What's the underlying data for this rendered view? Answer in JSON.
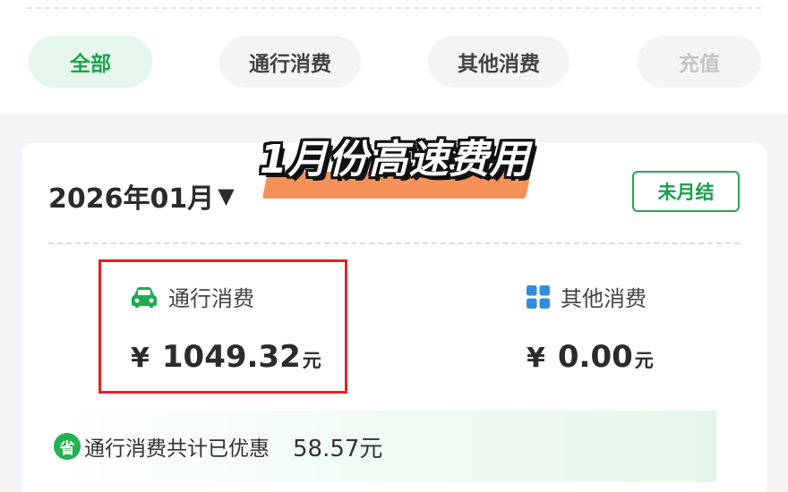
{
  "tabs": [
    {
      "label": "全部"
    },
    {
      "label": "通行消费"
    },
    {
      "label": "其他消费"
    },
    {
      "label": "充值"
    }
  ],
  "overlay": {
    "title": "1月份高速费用"
  },
  "summary": {
    "month": "2026年01月",
    "caret": "▼",
    "status_label": "未月结"
  },
  "toll": {
    "icon": "car-icon",
    "label": "通行消费",
    "currency": "¥",
    "amount": "1049.32",
    "unit": "元"
  },
  "other": {
    "icon": "grid-icon",
    "label": "其他消费",
    "currency": "¥",
    "amount": "0.00",
    "unit": "元"
  },
  "discount": {
    "badge": "省",
    "label": "通行消费共计已优惠",
    "value": "58.57元"
  },
  "colors": {
    "accent": "#17a74b",
    "highlight_box": "#e02323",
    "overlay_underline": "#f5925a"
  }
}
